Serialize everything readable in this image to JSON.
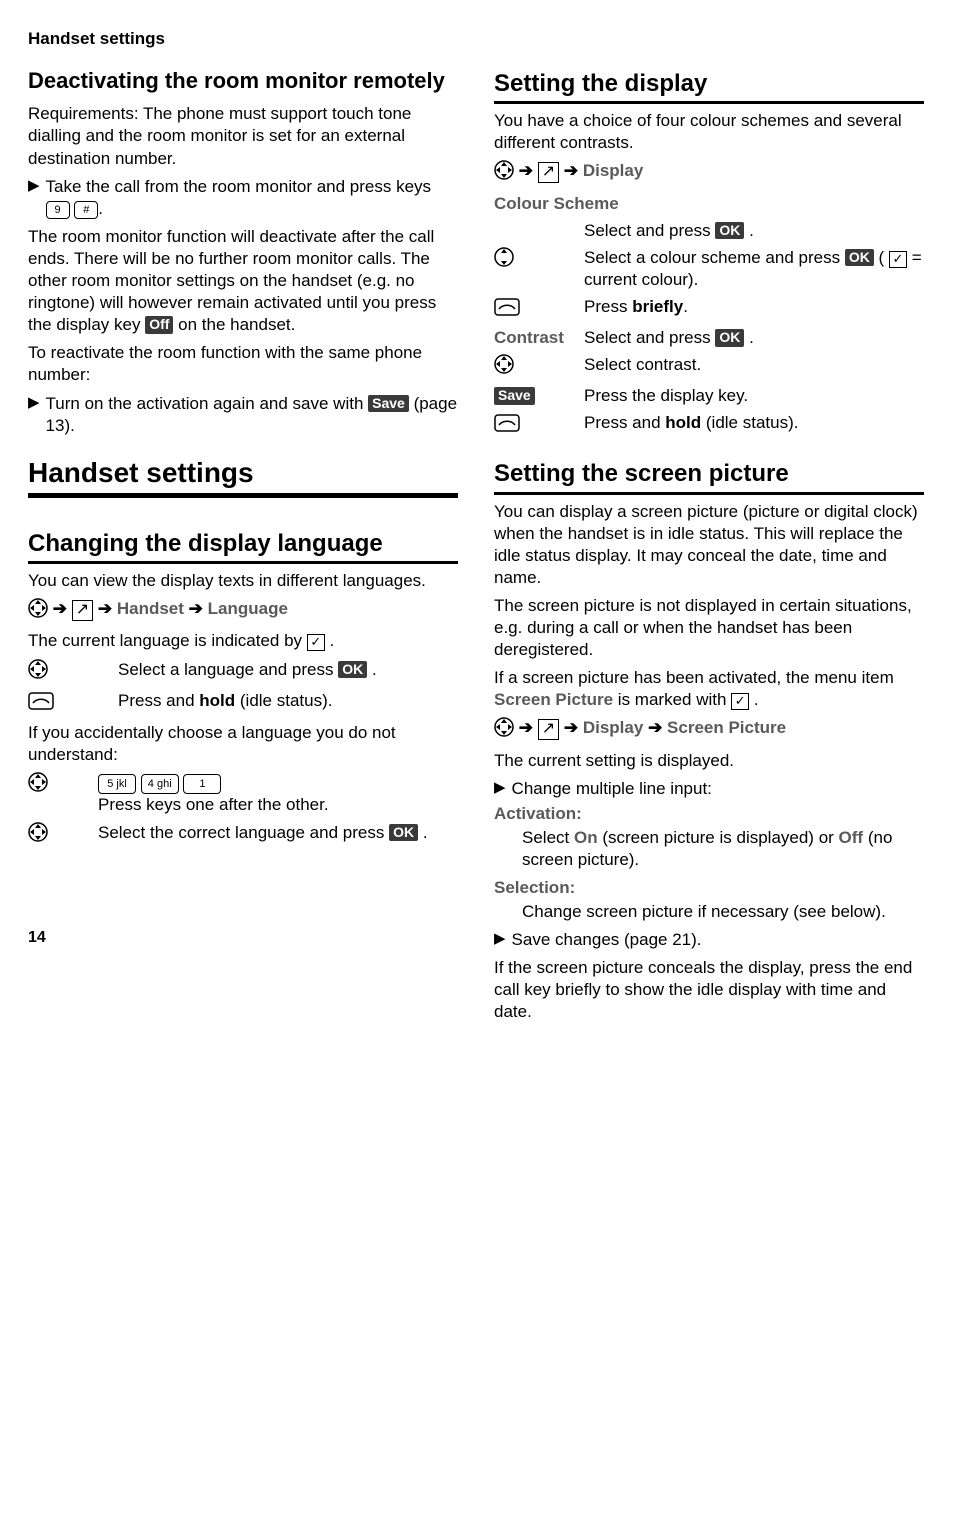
{
  "header": "Handset settings",
  "pageNumber": "14",
  "left": {
    "sub1": "Deactivating the room monitor remotely",
    "req": "Requirements: The phone must support touch tone dialling and the room monitor is set for an external destination number.",
    "bullet1a": "Take the call from the room monitor and press keys ",
    "bullet1_key1": "9",
    "bullet1_key2": "#",
    "para1a": "The room monitor function will deactivate after the call ends. There will be no further room monitor calls. The other room monitor settings on the handset (e.g. no ringtone) will however remain activated until you press the display key ",
    "para1b": " on the handset.",
    "offKey": "Off",
    "para2": "To reactivate the room function with the same phone number:",
    "bullet2a": "Turn on the activation again and save with ",
    "bullet2b": " (page 13).",
    "saveKey": "Save",
    "h1": "Handset settings",
    "h2a": "Changing the display language",
    "langIntro": "You can view the display texts in different languages.",
    "pathLang_a": "Handset",
    "pathLang_b": "Language",
    "langCurrent_a": "The current language is indicated by ",
    "langCurrent_b": ".",
    "check": "✓",
    "lang_step1_a": "Select a language and press ",
    "lang_step1_b": ".",
    "okKey": "OK",
    "lang_step2_a": "Press and ",
    "lang_step2_bold": "hold",
    "lang_step2_b": " (idle status).",
    "langAcc": "If you accidentally choose a language you do not understand:",
    "key5": "5 jkl",
    "key4": "4 ghi",
    "key1": "1 ",
    "lang_step3": "Press keys one after the other.",
    "lang_step4_a": "Select the correct language and press ",
    "lang_step4_b": "."
  },
  "right": {
    "h2a": "Setting the display",
    "dispIntro": "You have a choice of four colour schemes and several different contrasts.",
    "pathDisp": "Display",
    "colourScheme": "Colour Scheme",
    "cs_step1_a": "Select and press ",
    "cs_step1_b": ".",
    "cs_step2_a": "Select a colour scheme and press ",
    "cs_step2_b": " (",
    "cs_step2_c": " = current colour).",
    "cs_step3_a": "Press ",
    "cs_step3_bold": "briefly",
    "cs_step3_b": ".",
    "contrastLabel": "Contrast",
    "cs_step4_a": "Select and press ",
    "cs_step4_b": ".",
    "cs_step5": "Select contrast.",
    "saveLabel": "Save",
    "cs_step6": "Press the display key.",
    "cs_step7_a": "Press and ",
    "cs_step7_bold": "hold",
    "cs_step7_b": " (idle status).",
    "h2b": "Setting the screen picture",
    "sp1": "You can display a screen picture (picture or digital clock) when the handset is in idle status. This will replace the idle status display. It may conceal the date, time and name.",
    "sp2": "The screen picture is not displayed in certain situations, e.g. during a call or when the handset has been deregistered.",
    "sp3a": "If a screen picture has been activated, the menu item ",
    "sp3_item": "Screen Picture",
    "sp3b": " is marked with ",
    "sp3c": ".",
    "sp_path_a": "Display",
    "sp_path_b": "Screen Picture",
    "sp4": "The current setting is displayed.",
    "sp_bullet": "Change multiple line input:",
    "activation": "Activation:",
    "act_a": "Select ",
    "act_on": "On",
    "act_b": " (screen picture is displayed) or ",
    "act_off": "Off",
    "act_c": " (no screen picture).",
    "selection": "Selection:",
    "sel_text": "Change screen picture if necessary (see below).",
    "save_bullet": "Save changes (page 21).",
    "sp_last": "If the screen picture conceals the display, press the end call key briefly to show the idle display with time and date."
  }
}
